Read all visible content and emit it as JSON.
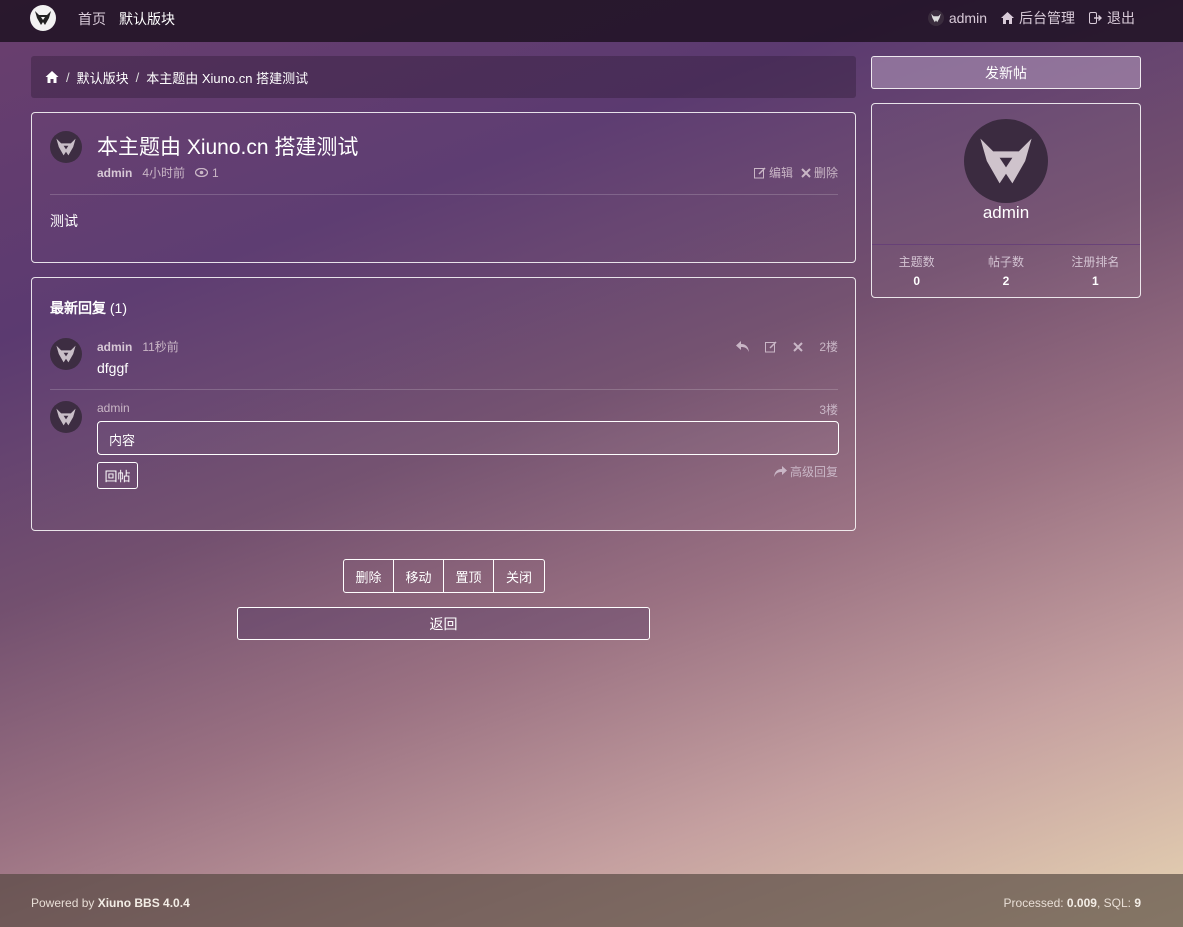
{
  "nav": {
    "home": "首页",
    "forum": "默认版块",
    "user": "admin",
    "admin_panel": "后台管理",
    "logout": "退出"
  },
  "breadcrumb": {
    "forum": "默认版块",
    "thread": "本主题由 Xiuno.cn 搭建测试",
    "separator": "/"
  },
  "thread": {
    "title": "本主题由 Xiuno.cn 搭建测试",
    "author": "admin",
    "time": "4小时前",
    "views": "1",
    "edit": "编辑",
    "delete": "删除",
    "body": "测试"
  },
  "replies": {
    "heading": "最新回复",
    "count": "(1)",
    "items": [
      {
        "author": "admin",
        "time": "11秒前",
        "content": "dfggf",
        "floor": "2楼"
      }
    ],
    "new_reply": {
      "author": "admin",
      "floor": "3楼",
      "placeholder": "内容",
      "submit": "回帖",
      "advanced": "高级回复"
    }
  },
  "mod_actions": [
    "删除",
    "移动",
    "置顶",
    "关闭"
  ],
  "back": "返回",
  "sidebar": {
    "new_thread": "发新帖",
    "username": "admin",
    "stats": [
      {
        "label": "主题数",
        "value": "0"
      },
      {
        "label": "帖子数",
        "value": "2"
      },
      {
        "label": "注册排名",
        "value": "1"
      }
    ]
  },
  "footer": {
    "powered_prefix": "Powered by",
    "powered_name": "Xiuno BBS 4.0.4",
    "processed_label": "Processed:",
    "processed_value": "0.009",
    "sql_label": ", SQL:",
    "sql_value": "9"
  }
}
